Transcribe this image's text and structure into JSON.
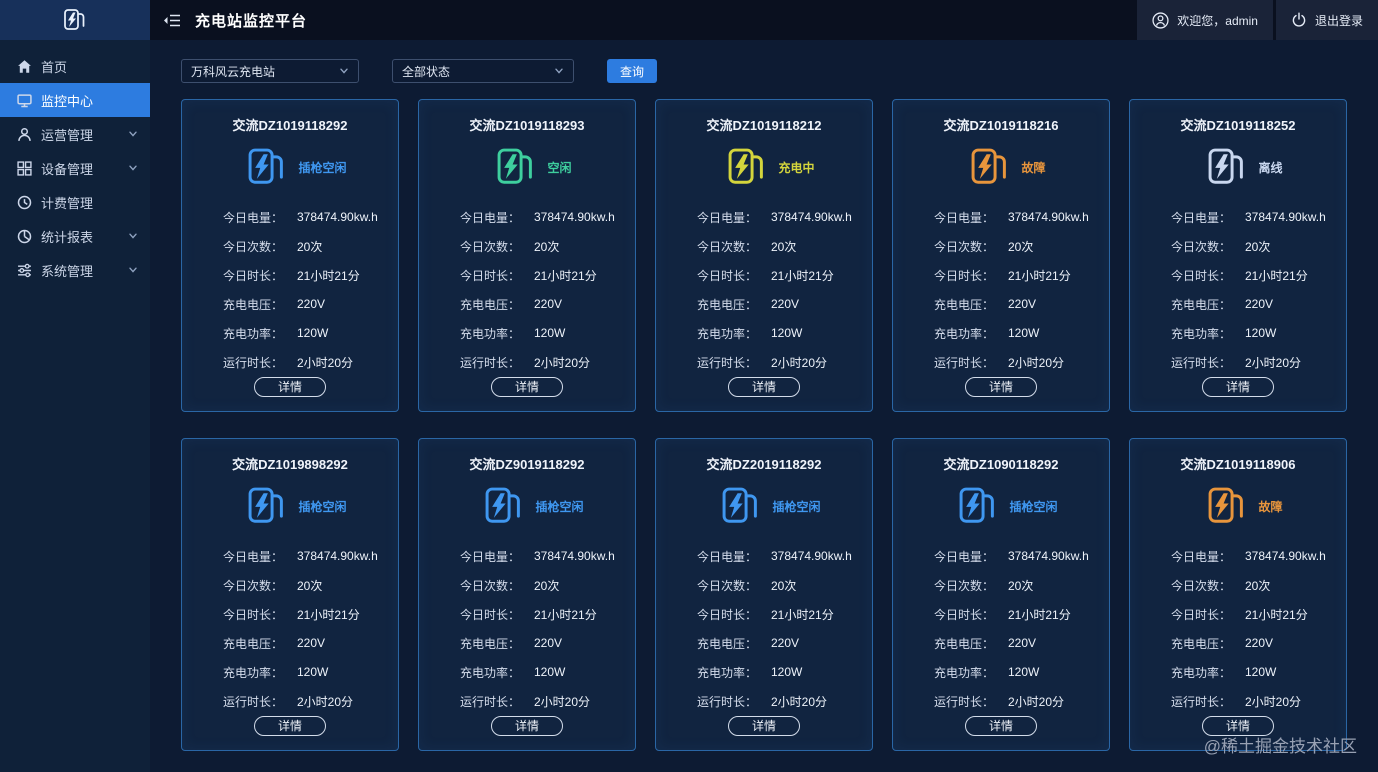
{
  "app": {
    "title": "充电站监控平台"
  },
  "header": {
    "welcome": "欢迎您，admin",
    "logout": "退出登录"
  },
  "sidebar": {
    "items": [
      {
        "label": "首页"
      },
      {
        "label": "监控中心"
      },
      {
        "label": "运营管理"
      },
      {
        "label": "设备管理"
      },
      {
        "label": "计费管理"
      },
      {
        "label": "统计报表"
      },
      {
        "label": "系统管理"
      }
    ]
  },
  "filters": {
    "station": "万科风云充电站",
    "status": "全部状态",
    "query": "查询"
  },
  "stat_labels": [
    "今日电量：",
    "今日次数：",
    "今日时长：",
    "充电电压：",
    "充电功率：",
    "运行时长："
  ],
  "labels": {
    "detail": "详情"
  },
  "colors": {
    "accent": "#2d7ce0",
    "idle_plug": "#3f97f0",
    "idle": "#3ecf9e",
    "charging": "#d4d53c",
    "fault": "#e8953c",
    "offline": "#c9d7ef"
  },
  "cards": [
    {
      "title": "交流DZ1019118292",
      "status": "插枪空闲",
      "color": "#3f97f0",
      "values": [
        "378474.90kw.h",
        "20次",
        "21小时21分",
        "220V",
        "120W",
        "2小时20分"
      ]
    },
    {
      "title": "交流DZ1019118293",
      "status": "空闲",
      "color": "#3ecf9e",
      "values": [
        "378474.90kw.h",
        "20次",
        "21小时21分",
        "220V",
        "120W",
        "2小时20分"
      ]
    },
    {
      "title": "交流DZ1019118212",
      "status": "充电中",
      "color": "#d4d53c",
      "values": [
        "378474.90kw.h",
        "20次",
        "21小时21分",
        "220V",
        "120W",
        "2小时20分"
      ]
    },
    {
      "title": "交流DZ1019118216",
      "status": "故障",
      "color": "#e8953c",
      "values": [
        "378474.90kw.h",
        "20次",
        "21小时21分",
        "220V",
        "120W",
        "2小时20分"
      ]
    },
    {
      "title": "交流DZ1019118252",
      "status": "离线",
      "color": "#c9d7ef",
      "values": [
        "378474.90kw.h",
        "20次",
        "21小时21分",
        "220V",
        "120W",
        "2小时20分"
      ]
    },
    {
      "title": "交流DZ1019898292",
      "status": "插枪空闲",
      "color": "#3f97f0",
      "values": [
        "378474.90kw.h",
        "20次",
        "21小时21分",
        "220V",
        "120W",
        "2小时20分"
      ]
    },
    {
      "title": "交流DZ9019118292",
      "status": "插枪空闲",
      "color": "#3f97f0",
      "values": [
        "378474.90kw.h",
        "20次",
        "21小时21分",
        "220V",
        "120W",
        "2小时20分"
      ]
    },
    {
      "title": "交流DZ2019118292",
      "status": "插枪空闲",
      "color": "#3f97f0",
      "values": [
        "378474.90kw.h",
        "20次",
        "21小时21分",
        "220V",
        "120W",
        "2小时20分"
      ]
    },
    {
      "title": "交流DZ1090118292",
      "status": "插枪空闲",
      "color": "#3f97f0",
      "values": [
        "378474.90kw.h",
        "20次",
        "21小时21分",
        "220V",
        "120W",
        "2小时20分"
      ]
    },
    {
      "title": "交流DZ1019118906",
      "status": "故障",
      "color": "#e8953c",
      "values": [
        "378474.90kw.h",
        "20次",
        "21小时21分",
        "220V",
        "120W",
        "2小时20分"
      ]
    }
  ],
  "watermark": "@稀土掘金技术社区"
}
